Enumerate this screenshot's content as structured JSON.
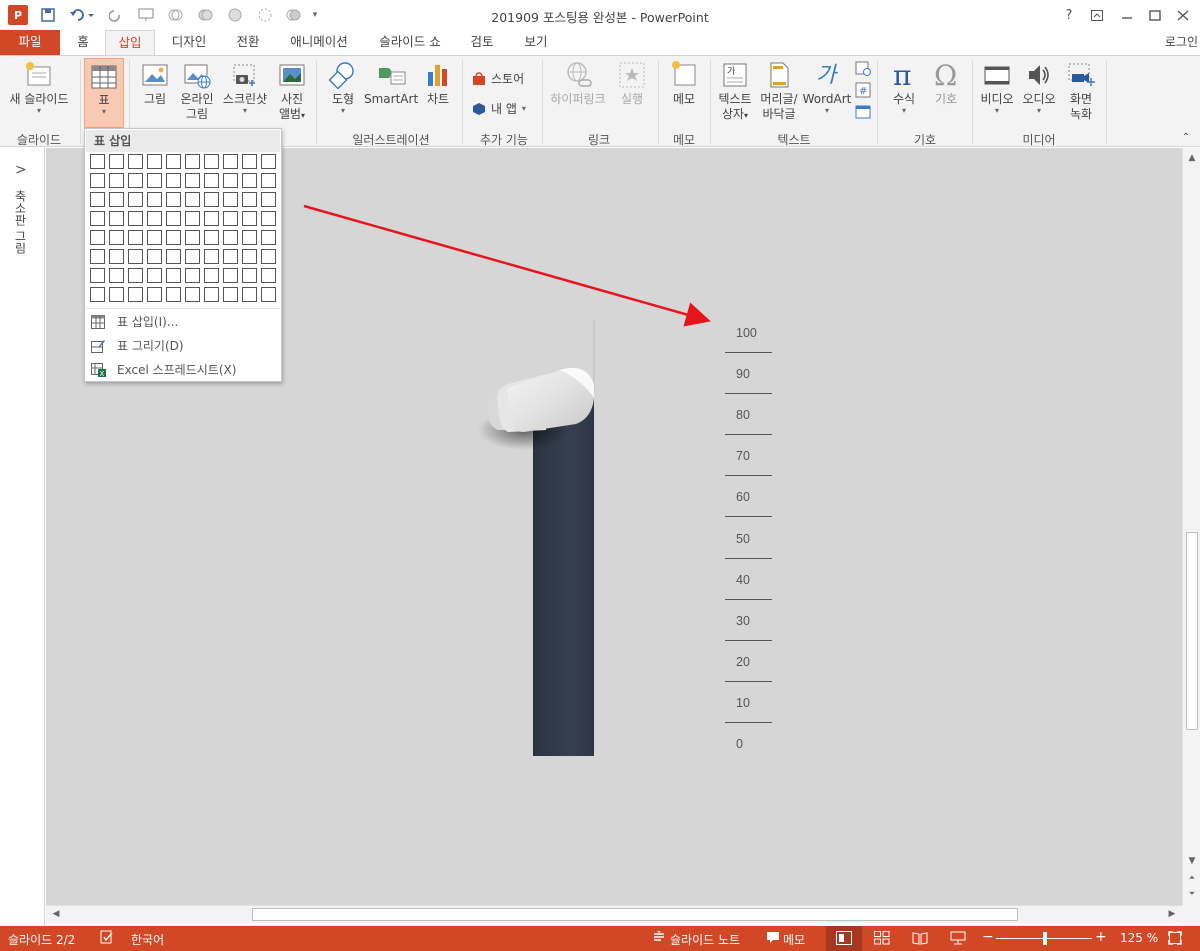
{
  "window": {
    "title": "201909 포스팅용 완성본 - PowerPoint",
    "app_icon_text": "P",
    "help": "?",
    "login": "로그인"
  },
  "tabs": [
    {
      "label": "파일"
    },
    {
      "label": "홈"
    },
    {
      "label": "삽입"
    },
    {
      "label": "디자인"
    },
    {
      "label": "전환"
    },
    {
      "label": "애니메이션"
    },
    {
      "label": "슬라이드 쇼"
    },
    {
      "label": "검토"
    },
    {
      "label": "보기"
    }
  ],
  "active_tab": "삽입",
  "ribbon": {
    "new_slide": "새 슬라이드",
    "table": "표",
    "picture": "그림",
    "online_picture_1": "온라인",
    "online_picture_2": "그림",
    "screenshot": "스크린샷",
    "photo_album_1": "사진",
    "photo_album_2": "앨범",
    "shapes": "도형",
    "smartart": "SmartArt",
    "chart": "차트",
    "store": "스토어",
    "my_apps": "내 앱",
    "hyperlink": "하이퍼링크",
    "action": "실행",
    "comment": "메모",
    "textbox_1": "텍스트",
    "textbox_2": "상자",
    "header_footer_1": "머리글/",
    "header_footer_2": "바닥글",
    "wordart": "WordArt",
    "equation": "수식",
    "symbol": "기호",
    "video": "비디오",
    "audio": "오디오",
    "screen_rec_1": "화면",
    "screen_rec_2": "녹화",
    "groups": {
      "slides": "슬라이드",
      "illustrations": "일러스트레이션",
      "addins": "추가 기능",
      "links": "링크",
      "comments": "메모",
      "text": "텍스트",
      "symbols": "기호",
      "media": "미디어"
    }
  },
  "left_pane": {
    "label": "축소판 그림",
    "chevron": ">"
  },
  "table_menu": {
    "title": "표 삽입",
    "rows": 8,
    "cols": 10,
    "items": [
      {
        "label": "표 삽입(I)..."
      },
      {
        "label": "표 그리기(D)"
      },
      {
        "label": "Excel 스프레드시트(X)"
      }
    ]
  },
  "slide": {
    "scale_labels": [
      "100",
      "90",
      "80",
      "70",
      "60",
      "50",
      "40",
      "30",
      "20",
      "10",
      "0"
    ],
    "colors": {
      "bar": "#323b48",
      "arrow": "#e8141c",
      "canvas": "#d6d6d6"
    }
  },
  "status": {
    "slide": "슬라이드 2/2",
    "language": "한국어",
    "notes": "슬라이드 노트",
    "comments": "메모",
    "zoom": "125 %"
  },
  "colors": {
    "accent": "#d24726",
    "ribbon_bg": "#f3f3f3"
  }
}
